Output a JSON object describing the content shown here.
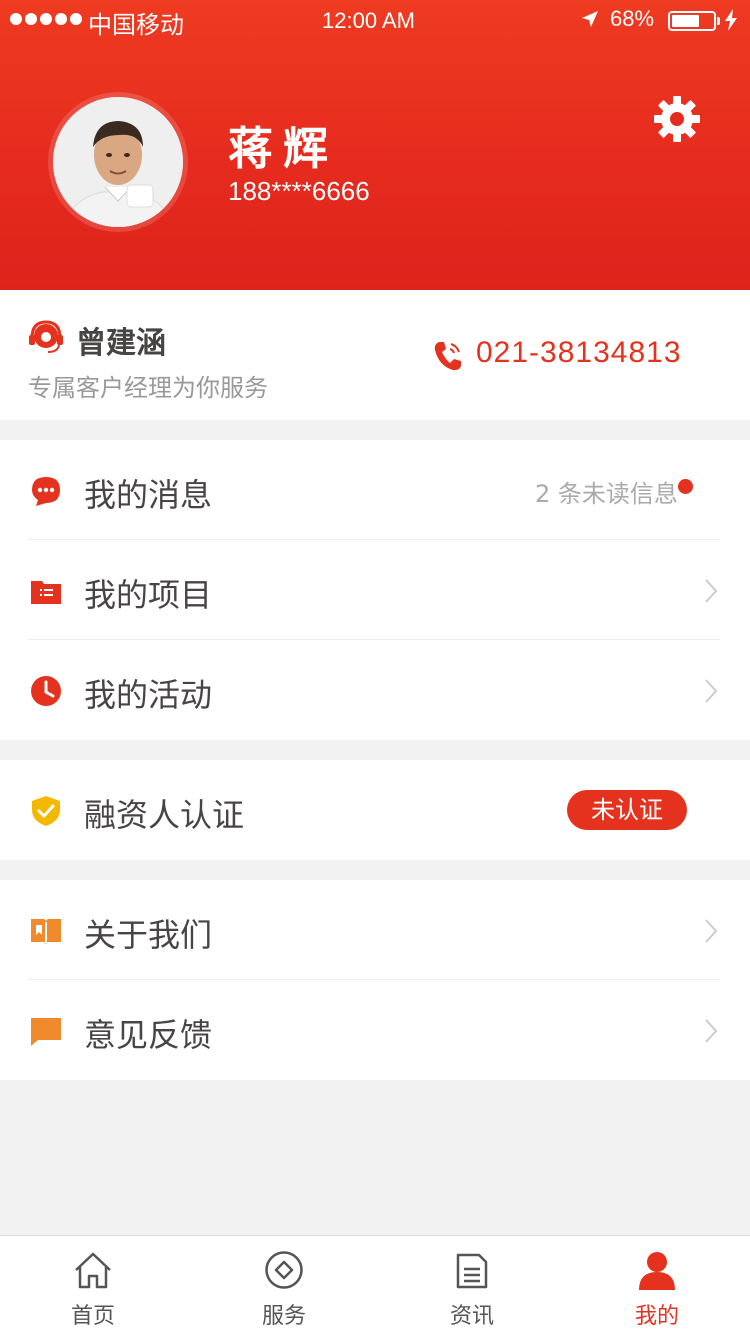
{
  "status_bar": {
    "carrier": "中国移动",
    "time": "12:00 AM",
    "battery": "68%",
    "battery_level": 0.68
  },
  "profile": {
    "name": "蒋辉",
    "phone": "188****6666"
  },
  "manager": {
    "name": "曾建涵",
    "subtitle": "专属客户经理为你服务",
    "phone": "021-38134813"
  },
  "menu": {
    "messages": {
      "label": "我的消息",
      "unread": "2 条未读信息"
    },
    "projects": {
      "label": "我的项目"
    },
    "activities": {
      "label": "我的活动"
    },
    "certification": {
      "label": "融资人认证",
      "status": "未认证"
    },
    "about": {
      "label": "关于我们"
    },
    "feedback": {
      "label": "意见反馈"
    }
  },
  "tabs": [
    {
      "label": "首页",
      "icon": "home-icon",
      "active": false
    },
    {
      "label": "服务",
      "icon": "service-icon",
      "active": false
    },
    {
      "label": "资讯",
      "icon": "news-icon",
      "active": false
    },
    {
      "label": "我的",
      "icon": "user-icon",
      "active": true
    }
  ],
  "colors": {
    "brand": "#E5321E",
    "text": "#484444",
    "sub_text": "#999999",
    "unread_text": "#AAAAAA",
    "divider": "#EEEEEE",
    "icon_orange": "#F08A2C",
    "icon_yellow": "#F5B800"
  }
}
